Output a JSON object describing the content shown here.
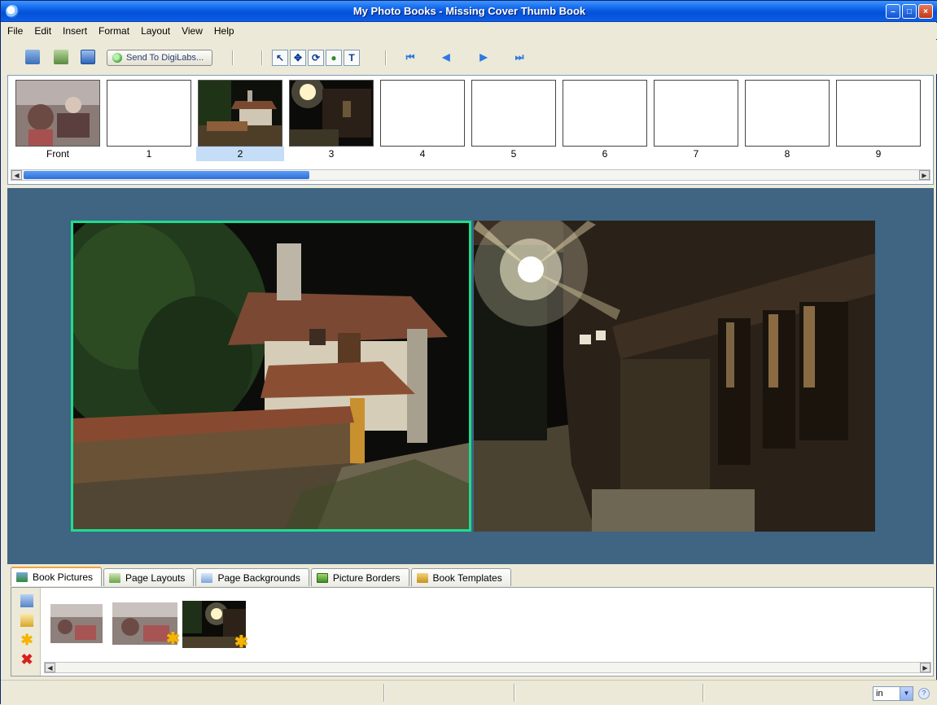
{
  "window": {
    "title": "My Photo Books - Missing Cover Thumb Book",
    "controls": [
      "minimize",
      "maximize",
      "close"
    ]
  },
  "menu": [
    "File",
    "Edit",
    "Insert",
    "Format",
    "Layout",
    "View",
    "Help"
  ],
  "toolbar": {
    "send_label": "Send To DigiLabs..."
  },
  "filmstrip": {
    "pages": [
      {
        "label": "Front",
        "has_photo": true
      },
      {
        "label": "1",
        "has_photo": false
      },
      {
        "label": "2",
        "has_photo": true,
        "selected": true
      },
      {
        "label": "3",
        "has_photo": true
      },
      {
        "label": "4",
        "has_photo": false
      },
      {
        "label": "5",
        "has_photo": false
      },
      {
        "label": "6",
        "has_photo": false
      },
      {
        "label": "7",
        "has_photo": false
      },
      {
        "label": "8",
        "has_photo": false
      },
      {
        "label": "9",
        "has_photo": false
      }
    ]
  },
  "tabs": [
    "Book Pictures",
    "Page Layouts",
    "Page Backgrounds",
    "Picture Borders",
    "Book Templates"
  ],
  "active_tab": "Book Pictures",
  "status": {
    "unit": "in"
  },
  "colors": {
    "canvas_bg": "#3f6582",
    "selection_border": "#1fdc8e",
    "title_bar": "#0a5de6"
  }
}
